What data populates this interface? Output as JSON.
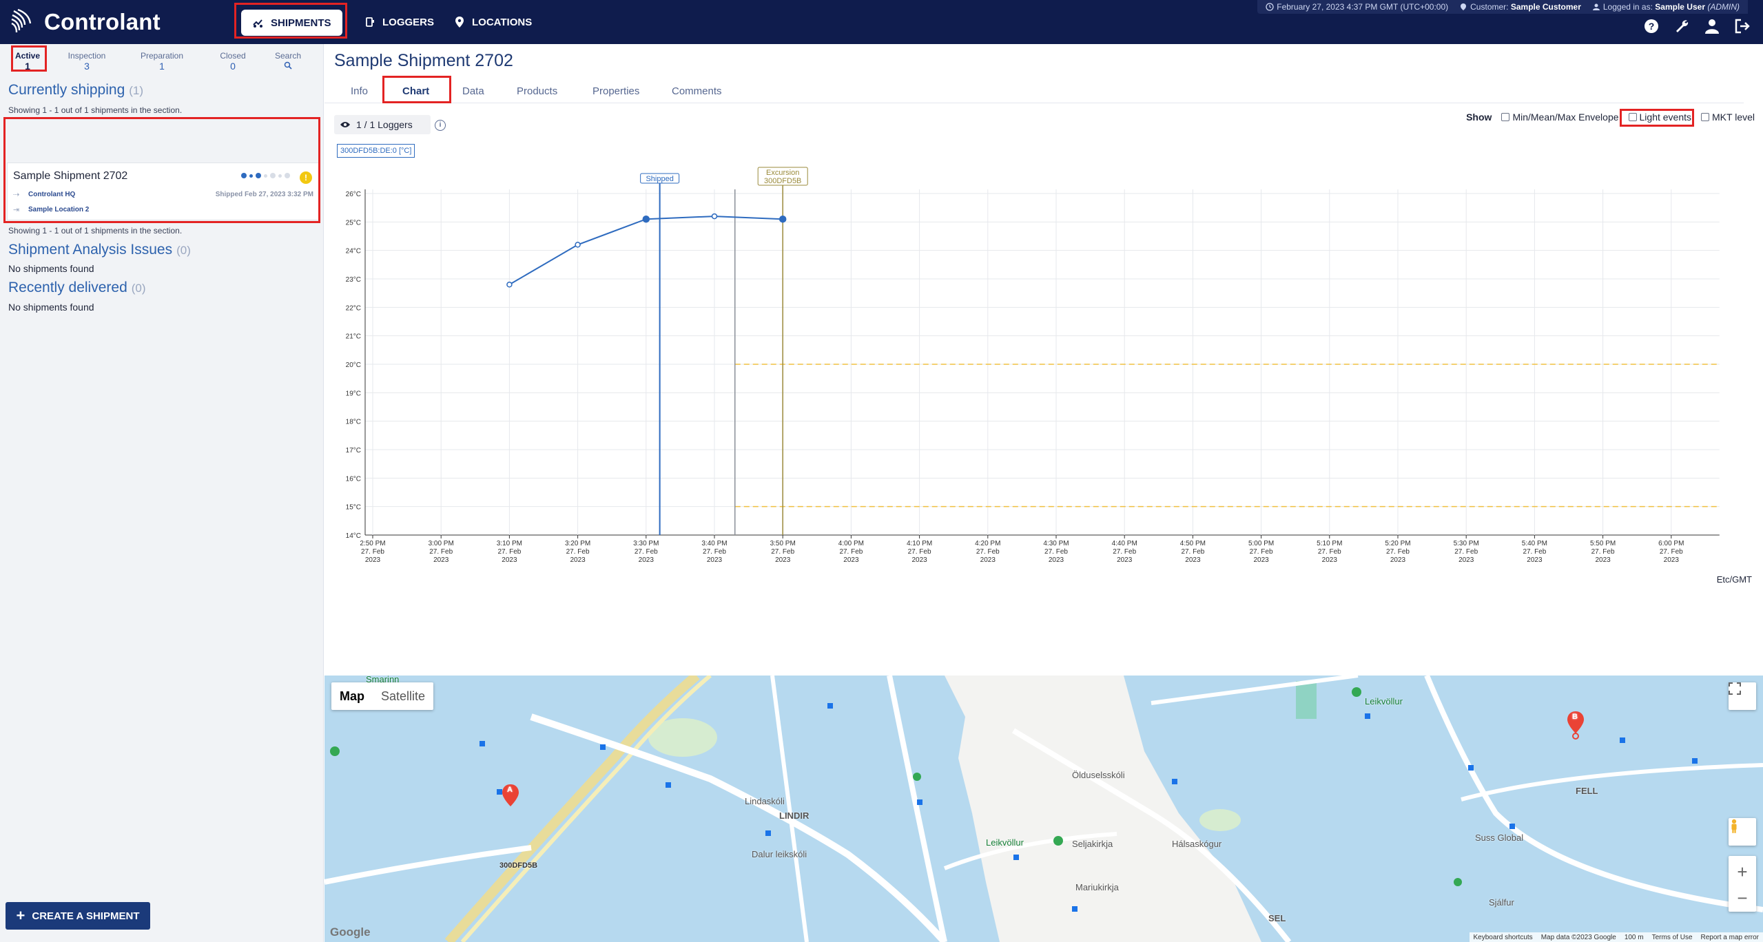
{
  "app": {
    "brand": "Controlant"
  },
  "nav": {
    "shipments": "SHIPMENTS",
    "loggers": "LOGGERS",
    "locations": "LOCATIONS"
  },
  "status": {
    "datetime": "February 27, 2023 4:37 PM GMT (UTC+00:00)",
    "customer_label": "Customer:",
    "customer": "Sample Customer",
    "logged_label": "Logged in as:",
    "user": "Sample User",
    "role": "(ADMIN)"
  },
  "left": {
    "tabs": [
      {
        "label": "Active",
        "count": "1"
      },
      {
        "label": "Inspection",
        "count": "3"
      },
      {
        "label": "Preparation",
        "count": "1"
      },
      {
        "label": "Closed",
        "count": "0"
      },
      {
        "label": "Search",
        "count": ""
      }
    ],
    "currently_shipping": {
      "title": "Currently shipping",
      "count": "(1)"
    },
    "showing_note": "Showing 1 - 1 out of 1 shipments in the section.",
    "card": {
      "title": "Sample Shipment 2702",
      "from": "Controlant HQ",
      "to": "Sample Location 2",
      "shipped": "Shipped Feb 27, 2023 3:32 PM",
      "warn": "!"
    },
    "analysis_issues": {
      "title": "Shipment Analysis Issues",
      "count": "(0)"
    },
    "recently_delivered": {
      "title": "Recently delivered",
      "count": "(0)"
    },
    "no_shipments": "No shipments found",
    "create_button": "CREATE A SHIPMENT"
  },
  "main": {
    "title": "Sample Shipment 2702",
    "tabs": [
      "Info",
      "Chart",
      "Data",
      "Products",
      "Properties",
      "Comments"
    ],
    "active_tab": "Chart",
    "loggers": "1 / 1 Loggers",
    "series_chip": "300DFD5B:DE:0 [°C]",
    "show": {
      "label": "Show",
      "options": [
        "Min/Mean/Max Envelope",
        "Light events",
        "MKT level"
      ]
    },
    "timezone": "Etc/GMT"
  },
  "chart_data": {
    "type": "line",
    "ylabel": "",
    "xlabel": "",
    "ylim": [
      14,
      26
    ],
    "y_ticks": [
      "14°C",
      "15°C",
      "16°C",
      "17°C",
      "18°C",
      "19°C",
      "20°C",
      "21°C",
      "22°C",
      "23°C",
      "24°C",
      "25°C",
      "26°C"
    ],
    "x_ticks": [
      "2:50 PM",
      "3:00 PM",
      "3:10 PM",
      "3:20 PM",
      "3:30 PM",
      "3:40 PM",
      "3:50 PM",
      "4:00 PM",
      "4:10 PM",
      "4:20 PM",
      "4:30 PM",
      "4:40 PM",
      "4:50 PM",
      "5:00 PM",
      "5:10 PM",
      "5:20 PM",
      "5:30 PM",
      "5:40 PM",
      "5:50 PM",
      "6:00 PM"
    ],
    "x_tick_date": "27. Feb",
    "x_tick_year": "2023",
    "series": [
      {
        "x": [
          "3:10 PM",
          "3:20 PM",
          "3:30 PM",
          "3:40 PM",
          "3:50 PM"
        ],
        "values": [
          22.8,
          24.2,
          25.1,
          25.2,
          25.1
        ]
      }
    ],
    "thresholds": [
      20,
      15
    ],
    "threshold_start": "3:43 PM",
    "events": [
      {
        "label": "Shipped",
        "x": "3:32 PM",
        "color": "#2e6bbf"
      },
      {
        "label": "Excursion",
        "sublabel": "300DFD5B",
        "x": "3:50 PM",
        "color": "#9a8a3a"
      }
    ],
    "marker_line_x": "3:43 PM",
    "grid": true,
    "colors": {
      "line": "#2e6bbf",
      "threshold": "#f0c040"
    }
  },
  "map": {
    "type_map": "Map",
    "type_satellite": "Satellite",
    "pin_a": "A",
    "pin_b": "B",
    "pin_a_label": "300DFD5B",
    "labels": [
      "Lindaskóli",
      "LINDIR",
      "Ölduselsskóli",
      "Seljakirkja",
      "Leikvöllur",
      "Mariukirkja",
      "Hálsaskógur",
      "Dalur leikskóli",
      "FELL",
      "Suss Global",
      "Sjálfur",
      "Smarinn",
      "Leikvöllur",
      "SEL"
    ],
    "zoom_in": "+",
    "zoom_out": "−",
    "attribution": [
      "Keyboard shortcuts",
      "Map data ©2023 Google",
      "100 m",
      "Terms of Use",
      "Report a map error"
    ],
    "google": "Google"
  }
}
